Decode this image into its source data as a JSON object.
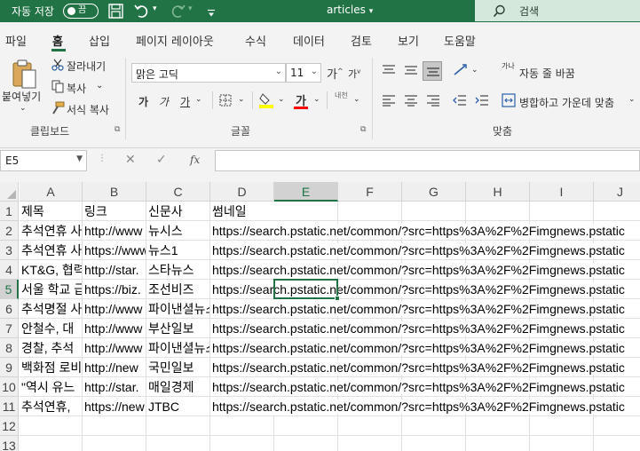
{
  "titlebar": {
    "autosave_label": "자동 저장",
    "autosave_state": "끔",
    "document_title": "articles",
    "search_placeholder": "검색"
  },
  "tabs": [
    "파일",
    "홈",
    "삽입",
    "페이지 레이아웃",
    "수식",
    "데이터",
    "검토",
    "보기",
    "도움말"
  ],
  "active_tab": "홈",
  "ribbon": {
    "clipboard": {
      "paste": "붙여넣기",
      "cut": "잘라내기",
      "copy": "복사",
      "format_painter": "서식 복사",
      "group_label": "클립보드"
    },
    "font": {
      "font_name": "맑은 고딕",
      "font_size": "11",
      "grow": "가",
      "shrink": "가",
      "bold": "가",
      "italic": "가",
      "underline": "가",
      "font_color": "가",
      "phonetic": "내천",
      "group_label": "글꼴",
      "fill_color": "#ffff00",
      "text_color": "#ff0000"
    },
    "alignment": {
      "wrap_text": "자동 줄 바꿈",
      "merge_center": "병합하고 가운데 맞춤",
      "group_label": "맞춤",
      "orientation_icon_text": "가나"
    }
  },
  "formula_bar": {
    "name_box": "E5",
    "fx": "fx",
    "formula": ""
  },
  "sheet": {
    "columns": [
      "A",
      "B",
      "C",
      "D",
      "E",
      "F",
      "G",
      "H",
      "I",
      "J"
    ],
    "selected_column": "E",
    "selected_row": "5",
    "rows": [
      "1",
      "2",
      "3",
      "4",
      "5",
      "6",
      "7",
      "8",
      "9",
      "10",
      "11",
      "12",
      "13"
    ],
    "data": [
      [
        "제목",
        "링크",
        "신문사",
        "썸네일"
      ],
      [
        "추석연휴 사",
        "http://www",
        "뉴시스",
        "https://search.pstatic.net/common/?src=https%3A%2F%2Fimgnews.pstatic"
      ],
      [
        "추석연휴 사",
        "https://www",
        "뉴스1",
        "https://search.pstatic.net/common/?src=https%3A%2F%2Fimgnews.pstatic"
      ],
      [
        "KT&G, 협력",
        "http://star.",
        "스타뉴스",
        "https://search.pstatic.net/common/?src=https%3A%2F%2Fimgnews.pstatic"
      ],
      [
        "서울 학교 급",
        "https://biz.",
        "조선비즈",
        "https://search.pstatic.net/common/?src=https%3A%2F%2Fimgnews.pstatic"
      ],
      [
        "추석명절 사",
        "http://www",
        "파이낸셜뉴스",
        "https://search.pstatic.net/common/?src=https%3A%2F%2Fimgnews.pstatic"
      ],
      [
        "안철수, 대",
        "http://www",
        "부산일보",
        "https://search.pstatic.net/common/?src=https%3A%2F%2Fimgnews.pstatic"
      ],
      [
        "경찰, 추석",
        "http://www",
        "파이낸셜뉴스",
        "https://search.pstatic.net/common/?src=https%3A%2F%2Fimgnews.pstatic"
      ],
      [
        "백화점 로비",
        "http://new",
        "국민일보",
        "https://search.pstatic.net/common/?src=https%3A%2F%2Fimgnews.pstatic"
      ],
      [
        "\"역시 유느",
        "http://star.",
        "매일경제",
        "https://search.pstatic.net/common/?src=https%3A%2F%2Fimgnews.pstatic"
      ],
      [
        "추석연휴,",
        "https://new",
        "JTBC",
        "https://search.pstatic.net/common/?src=https%3A%2F%2Fimgnews.pstatic"
      ]
    ]
  }
}
